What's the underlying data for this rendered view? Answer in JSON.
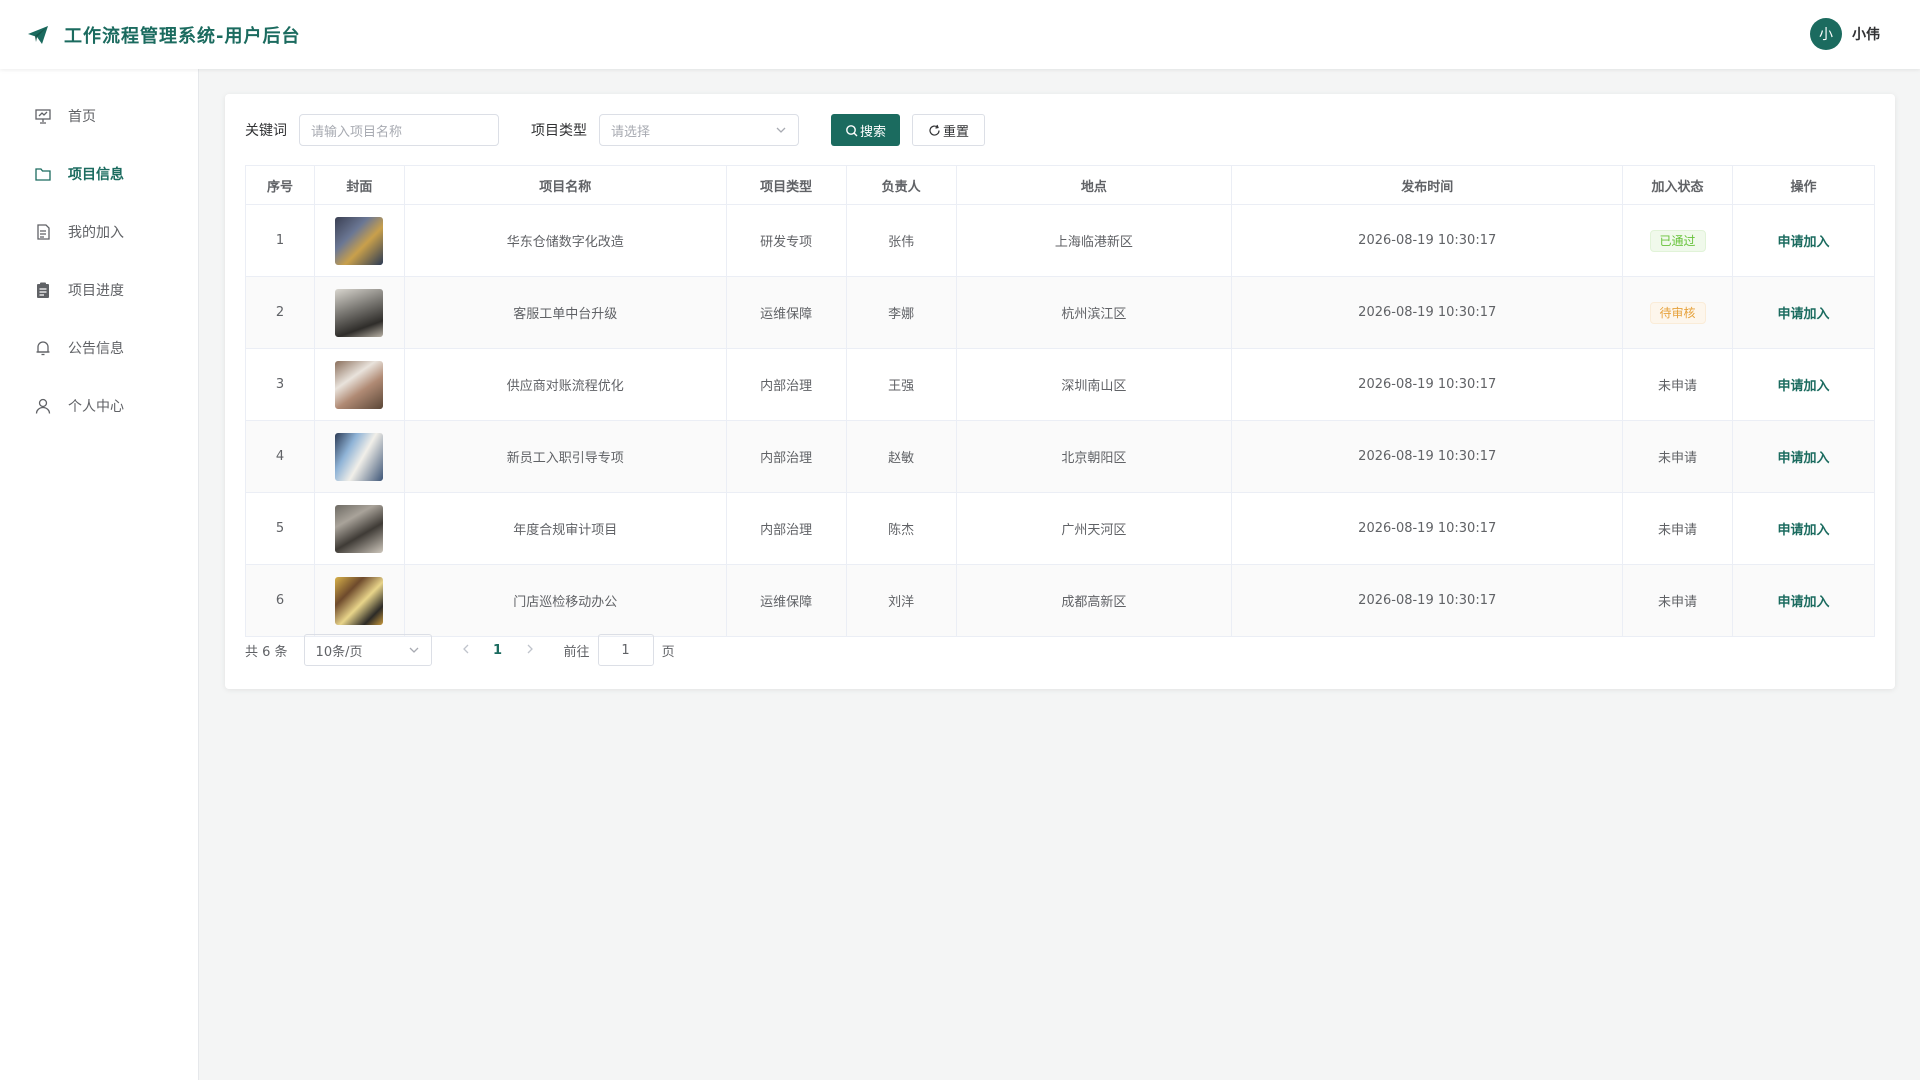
{
  "header": {
    "title": "工作流程管理系统-用户后台",
    "user_avatar_text": "小",
    "user_name": "小伟"
  },
  "sidebar": {
    "items": [
      {
        "label": "首页",
        "icon": "presentation-icon",
        "active": false
      },
      {
        "label": "项目信息",
        "icon": "folder-icon",
        "active": true
      },
      {
        "label": "我的加入",
        "icon": "document-icon",
        "active": false
      },
      {
        "label": "项目进度",
        "icon": "clipboard-icon",
        "active": false
      },
      {
        "label": "公告信息",
        "icon": "bell-icon",
        "active": false
      },
      {
        "label": "个人中心",
        "icon": "user-icon",
        "active": false
      }
    ]
  },
  "filter": {
    "keyword_label": "关键词",
    "keyword_placeholder": "请输入项目名称",
    "type_label": "项目类型",
    "type_placeholder": "请选择",
    "search_label": "搜索",
    "reset_label": "重置"
  },
  "table": {
    "columns": [
      "序号",
      "封面",
      "项目名称",
      "项目类型",
      "负责人",
      "地点",
      "发布时间",
      "加入状态",
      "操作"
    ],
    "rows": [
      {
        "index": "1",
        "name": "华东仓储数字化改造",
        "type": "研发专项",
        "owner": "张伟",
        "location": "上海临港新区",
        "time": "2026-08-19 10:30:17",
        "status": "已通过",
        "status_kind": "pass",
        "action": "申请加入"
      },
      {
        "index": "2",
        "name": "客服工单中台升级",
        "type": "运维保障",
        "owner": "李娜",
        "location": "杭州滨江区",
        "time": "2026-08-19 10:30:17",
        "status": "待审核",
        "status_kind": "wait",
        "action": "申请加入"
      },
      {
        "index": "3",
        "name": "供应商对账流程优化",
        "type": "内部治理",
        "owner": "王强",
        "location": "深圳南山区",
        "time": "2026-08-19 10:30:17",
        "status": "未申请",
        "status_kind": "none",
        "action": "申请加入"
      },
      {
        "index": "4",
        "name": "新员工入职引导专项",
        "type": "内部治理",
        "owner": "赵敏",
        "location": "北京朝阳区",
        "time": "2026-08-19 10:30:17",
        "status": "未申请",
        "status_kind": "none",
        "action": "申请加入"
      },
      {
        "index": "5",
        "name": "年度合规审计项目",
        "type": "内部治理",
        "owner": "陈杰",
        "location": "广州天河区",
        "time": "2026-08-19 10:30:17",
        "status": "未申请",
        "status_kind": "none",
        "action": "申请加入"
      },
      {
        "index": "6",
        "name": "门店巡检移动办公",
        "type": "运维保障",
        "owner": "刘洋",
        "location": "成都高新区",
        "time": "2026-08-19 10:30:17",
        "status": "未申请",
        "status_kind": "none",
        "action": "申请加入"
      }
    ]
  },
  "pagination": {
    "total_text": "共 6 条",
    "page_size": "10条/页",
    "current_page": "1",
    "goto_label": "前往",
    "goto_value": "1",
    "page_suffix": "页"
  },
  "colors": {
    "primary": "#1b6b5f",
    "pass": "#67c23a",
    "wait": "#e6a23c"
  }
}
